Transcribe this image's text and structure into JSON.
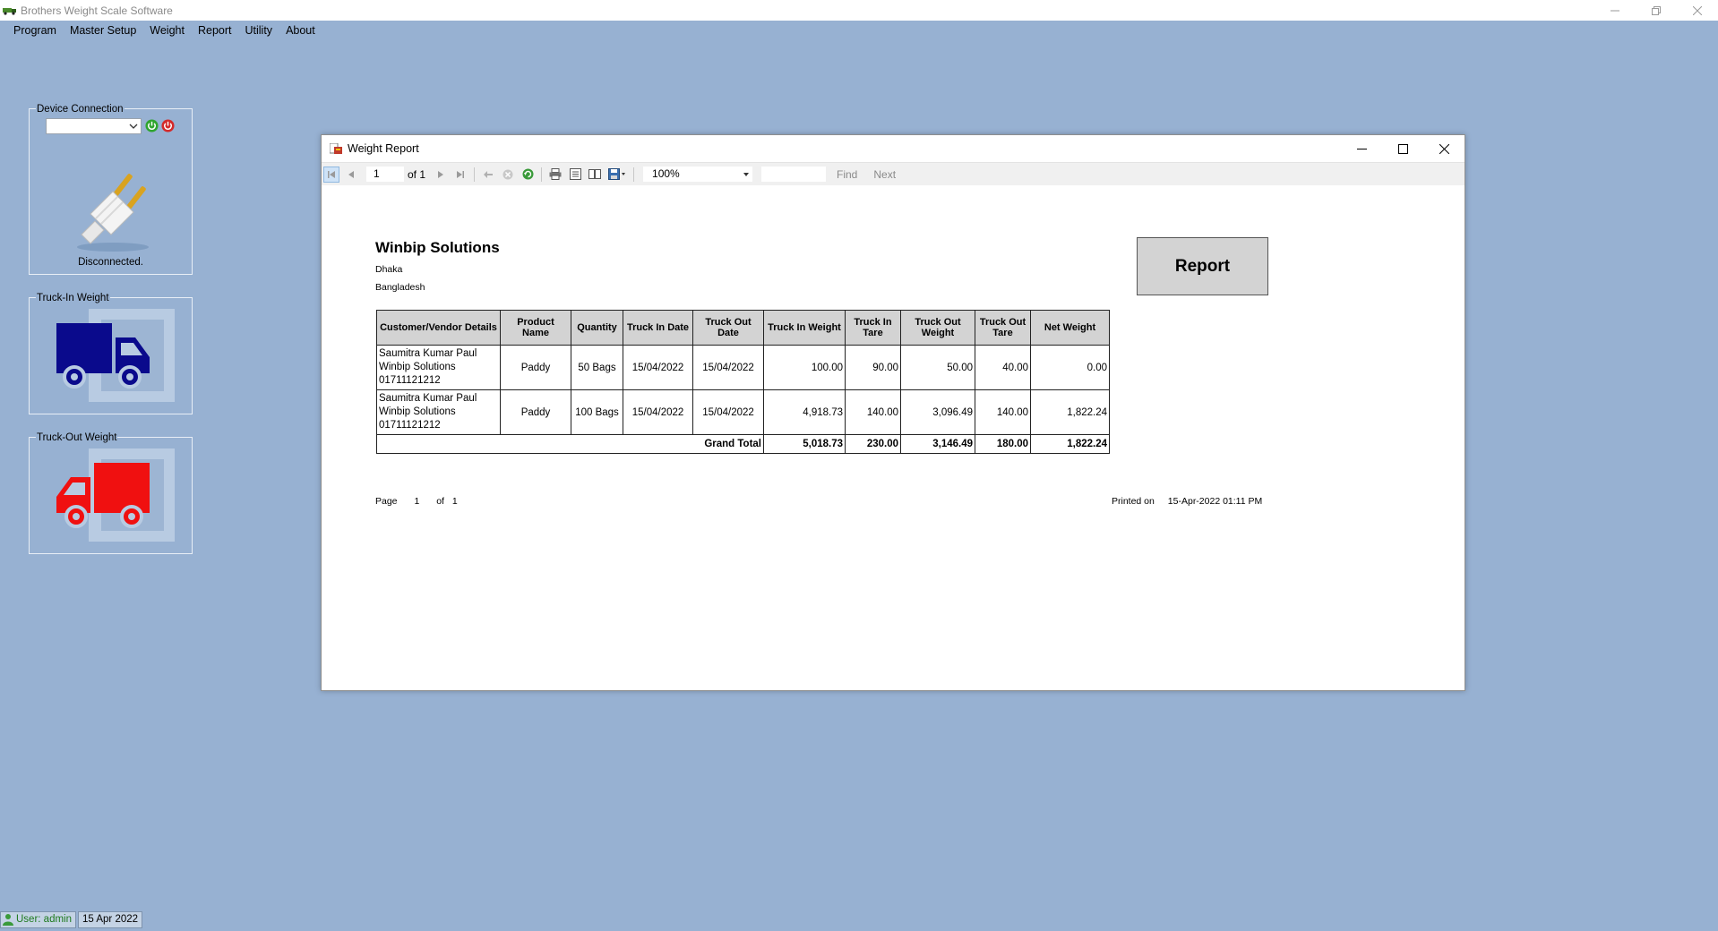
{
  "app": {
    "title": "Brothers Weight Scale Software"
  },
  "menu": [
    "Program",
    "Master Setup",
    "Weight",
    "Report",
    "Utility",
    "About"
  ],
  "device": {
    "label": "Device Connection",
    "selected": "",
    "status": "Disconnected."
  },
  "truck_in": {
    "label": "Truck-In Weight",
    "color": "#0a0a8c"
  },
  "truck_out": {
    "label": "Truck-Out Weight",
    "color": "#f01010"
  },
  "report_window": {
    "title": "Weight Report",
    "toolbar": {
      "page": "1",
      "of_label": "of 1",
      "zoom": "100%",
      "find_label": "Find",
      "next_label": "Next"
    }
  },
  "report": {
    "company": "Winbip Solutions",
    "address_line1": "Dhaka",
    "address_line2": "Bangladesh",
    "badge": "Report",
    "columns": [
      "Customer/Vendor Details",
      "Product Name",
      "Quantity",
      "Truck In Date",
      "Truck Out Date",
      "Truck In Weight",
      "Truck In Tare",
      "Truck Out Weight",
      "Truck Out Tare",
      "Net Weight"
    ],
    "rows": [
      {
        "customer": [
          "Saumitra Kumar Paul",
          "Winbip Solutions",
          "01711121212"
        ],
        "product": "Paddy",
        "quantity": "50 Bags",
        "in_date": "15/04/2022",
        "out_date": "15/04/2022",
        "in_weight": "100.00",
        "in_tare": "90.00",
        "out_weight": "50.00",
        "out_tare": "40.00",
        "net": "0.00"
      },
      {
        "customer": [
          "Saumitra Kumar Paul",
          "Winbip Solutions",
          "01711121212"
        ],
        "product": "Paddy",
        "quantity": "100 Bags",
        "in_date": "15/04/2022",
        "out_date": "15/04/2022",
        "in_weight": "4,918.73",
        "in_tare": "140.00",
        "out_weight": "3,096.49",
        "out_tare": "140.00",
        "net": "1,822.24"
      }
    ],
    "total": {
      "label": "Grand Total",
      "in_weight": "5,018.73",
      "in_tare": "230.00",
      "out_weight": "3,146.49",
      "out_tare": "180.00",
      "net": "1,822.24"
    },
    "footer": {
      "page_label": "Page",
      "page": "1",
      "of_label": "of",
      "of": "1",
      "printed_label": "Printed on",
      "printed": "15-Apr-2022 01:11 PM"
    }
  },
  "statusbar": {
    "user": "User: admin",
    "date": "15 Apr 2022"
  }
}
